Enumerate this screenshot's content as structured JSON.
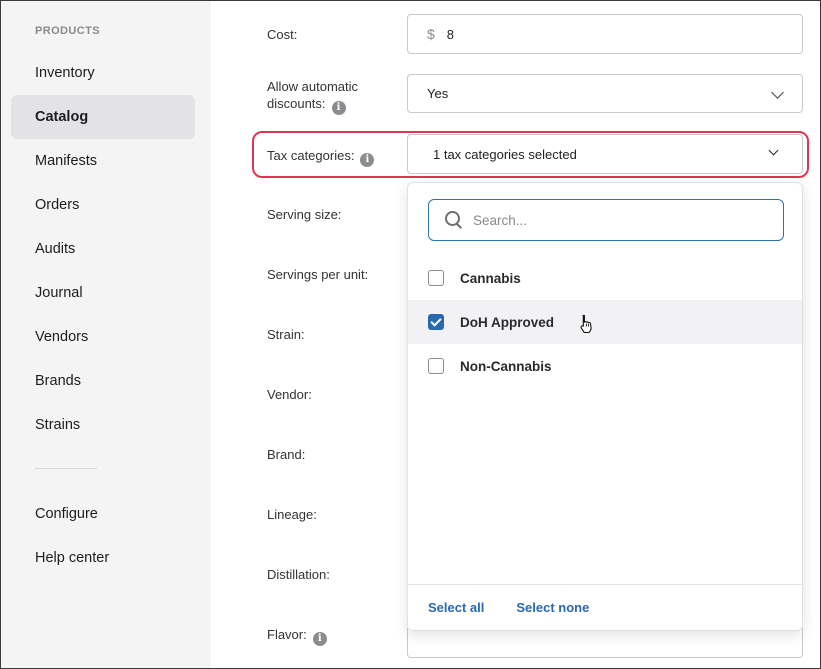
{
  "sidebar": {
    "heading": "PRODUCTS",
    "items": [
      {
        "label": "Inventory"
      },
      {
        "label": "Catalog",
        "active": true
      },
      {
        "label": "Manifests"
      },
      {
        "label": "Orders"
      },
      {
        "label": "Audits"
      },
      {
        "label": "Journal"
      },
      {
        "label": "Vendors"
      },
      {
        "label": "Brands"
      },
      {
        "label": "Strains"
      }
    ],
    "bottom_items": [
      {
        "label": "Configure"
      },
      {
        "label": "Help center"
      }
    ]
  },
  "form": {
    "cost": {
      "label": "Cost:",
      "currency": "$",
      "value": "8"
    },
    "discounts": {
      "label_line1": "Allow automatic",
      "label_line2": "discounts:",
      "value": "Yes",
      "info_icon": "info-icon"
    },
    "tax": {
      "label": "Tax categories:",
      "value": "1 tax categories selected",
      "info_icon": "info-icon"
    },
    "fields": [
      {
        "label": "Serving size:"
      },
      {
        "label": "Servings per unit:"
      },
      {
        "label": "Strain:"
      },
      {
        "label": "Vendor:"
      },
      {
        "label": "Brand:"
      },
      {
        "label": "Lineage:"
      },
      {
        "label": "Distillation:"
      },
      {
        "label": "Flavor:"
      }
    ]
  },
  "dropdown": {
    "search_placeholder": "Search...",
    "options": [
      {
        "label": "Cannabis",
        "checked": false
      },
      {
        "label": "DoH Approved",
        "checked": true
      },
      {
        "label": "Non-Cannabis",
        "checked": false
      }
    ],
    "select_all": "Select all",
    "select_none": "Select none"
  },
  "colors": {
    "accent": "#2869b0",
    "highlight": "#e0364f",
    "sidebar_bg": "#f4f4f5"
  }
}
